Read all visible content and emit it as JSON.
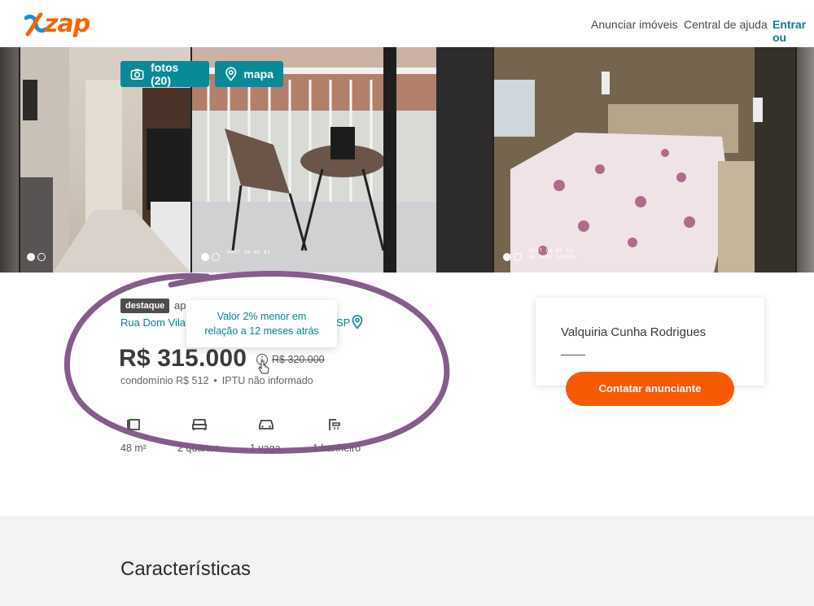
{
  "header": {
    "brand": "zap",
    "nav": [
      "Anunciar imóveis",
      "Central de ajuda",
      "Entrar ou"
    ]
  },
  "gallery": {
    "photos_button": "fotos (20)",
    "map_button": "mapa",
    "photo_captions": [
      "SHOT ON MI A1",
      "SHOT ON MI A1",
      "MI DUAL CAMERA"
    ]
  },
  "listing": {
    "badge": "destaque",
    "type": "ap",
    "address_start": "Rua Dom Vilar",
    "address_end": "SP",
    "tooltip": [
      "Valor 2% menor em",
      "relação a 12 meses atrás"
    ],
    "price": "R$ 315.000",
    "old_price": "R$ 320.000",
    "condo": "condomínio R$ 512",
    "separator": "•",
    "iptu": "IPTU não informado",
    "features": [
      {
        "label": "48 m²"
      },
      {
        "label": "2 quartos"
      },
      {
        "label": "1 vaga"
      },
      {
        "label": "1 banheiro"
      }
    ]
  },
  "seller": {
    "name": "Valquiria Cunha Rodrigues",
    "contact_button": "Contatar anunciante"
  },
  "sections": {
    "characteristics_title": "Características"
  },
  "colors": {
    "brand_orange": "#f56400",
    "teal": "#0a8a96",
    "cta": "#f75a00",
    "annotation": "#7a4f80"
  }
}
